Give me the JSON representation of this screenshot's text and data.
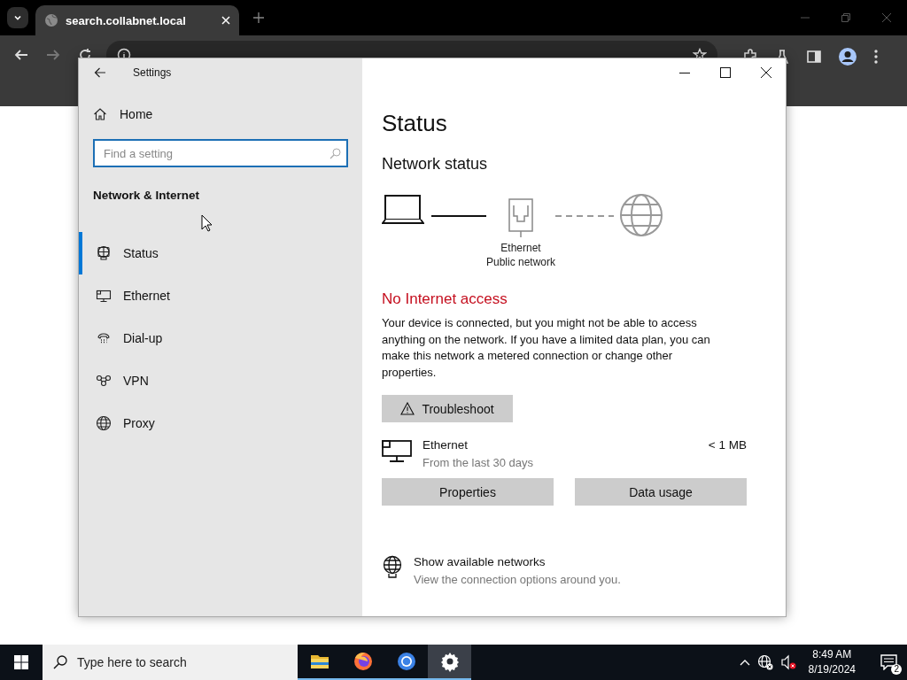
{
  "browser": {
    "tab": {
      "title": "search.collabnet.local"
    }
  },
  "settings": {
    "title": "Settings",
    "home": "Home",
    "search": {
      "placeholder": "Find a setting"
    },
    "section": "Network & Internet",
    "nav": [
      {
        "label": "Status",
        "selected": true
      },
      {
        "label": "Ethernet",
        "selected": false
      },
      {
        "label": "Dial-up",
        "selected": false
      },
      {
        "label": "VPN",
        "selected": false
      },
      {
        "label": "Proxy",
        "selected": false
      }
    ],
    "heading": "Status",
    "subheading": "Network status",
    "diagram": {
      "adapter": "Ethernet",
      "network": "Public network",
      "internet_connected": false
    },
    "alert": "No Internet access",
    "description": "Your device is connected, but you might not be able to access anything on the network. If you have a limited data plan, you can make this network a metered connection or change other properties.",
    "troubleshoot": "Troubleshoot",
    "connection": {
      "name": "Ethernet",
      "subtitle": "From the last 30 days",
      "usage": "< 1 MB"
    },
    "buttons": [
      "Properties",
      "Data usage"
    ],
    "link": {
      "title": "Show available networks",
      "subtitle": "View the connection options around you."
    }
  },
  "taskbar": {
    "search": {
      "placeholder": "Type here to search"
    },
    "apps": [
      {
        "active": false
      },
      {
        "active": false
      },
      {
        "active": false
      },
      {
        "active": true
      }
    ],
    "time": "8:49 AM",
    "date": "8/19/2024",
    "notifications": "2"
  }
}
